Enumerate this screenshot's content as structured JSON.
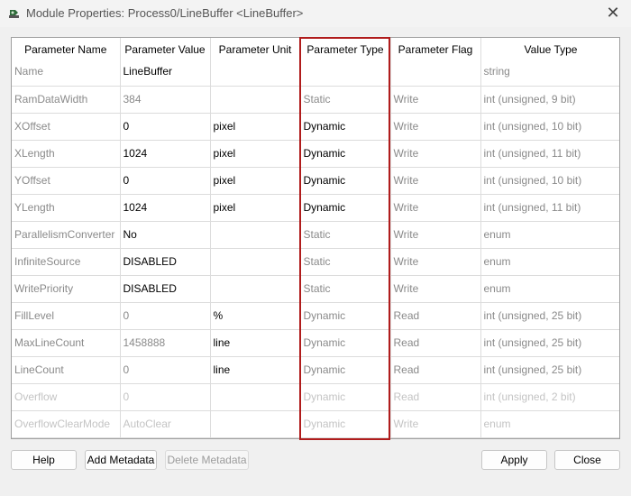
{
  "window": {
    "title": "Module Properties: Process0/LineBuffer <LineBuffer>",
    "close_glyph": "✕",
    "icon": "module-icon"
  },
  "table": {
    "headers": [
      "Parameter Name",
      "Parameter Value",
      "Parameter Unit",
      "Parameter Type",
      "Parameter Flag",
      "Value Type"
    ],
    "rows": [
      {
        "name": "Name",
        "value": "LineBuffer",
        "unit": "",
        "type": "",
        "flag": "",
        "vtype": "string",
        "style": [
          "g",
          "k",
          "g",
          "g",
          "g",
          "g"
        ]
      },
      {
        "name": "RamDataWidth",
        "value": "384",
        "unit": "",
        "type": "Static",
        "flag": "Write",
        "vtype": "int (unsigned, 9 bit)",
        "style": [
          "g",
          "g",
          "g",
          "g",
          "g",
          "g"
        ]
      },
      {
        "name": "XOffset",
        "value": "0",
        "unit": "pixel",
        "type": "Dynamic",
        "flag": "Write",
        "vtype": "int (unsigned, 10 bit)",
        "style": [
          "g",
          "k",
          "k",
          "k",
          "g",
          "g"
        ]
      },
      {
        "name": "XLength",
        "value": "1024",
        "unit": "pixel",
        "type": "Dynamic",
        "flag": "Write",
        "vtype": "int (unsigned, 11 bit)",
        "style": [
          "g",
          "k",
          "k",
          "k",
          "g",
          "g"
        ]
      },
      {
        "name": "YOffset",
        "value": "0",
        "unit": "pixel",
        "type": "Dynamic",
        "flag": "Write",
        "vtype": "int (unsigned, 10 bit)",
        "style": [
          "g",
          "k",
          "k",
          "k",
          "g",
          "g"
        ]
      },
      {
        "name": "YLength",
        "value": "1024",
        "unit": "pixel",
        "type": "Dynamic",
        "flag": "Write",
        "vtype": "int (unsigned, 11 bit)",
        "style": [
          "g",
          "k",
          "k",
          "k",
          "g",
          "g"
        ]
      },
      {
        "name": "ParallelismConverter",
        "value": "No",
        "unit": "",
        "type": "Static",
        "flag": "Write",
        "vtype": "enum",
        "style": [
          "g",
          "k",
          "g",
          "g",
          "g",
          "g"
        ]
      },
      {
        "name": "InfiniteSource",
        "value": "DISABLED",
        "unit": "",
        "type": "Static",
        "flag": "Write",
        "vtype": "enum",
        "style": [
          "g",
          "k",
          "g",
          "g",
          "g",
          "g"
        ]
      },
      {
        "name": "WritePriority",
        "value": "DISABLED",
        "unit": "",
        "type": "Static",
        "flag": "Write",
        "vtype": "enum",
        "style": [
          "g",
          "k",
          "g",
          "g",
          "g",
          "g"
        ]
      },
      {
        "name": "FillLevel",
        "value": "0",
        "unit": "%",
        "type": "Dynamic",
        "flag": "Read",
        "vtype": "int (unsigned, 25 bit)",
        "style": [
          "g",
          "g",
          "k",
          "g",
          "g",
          "g"
        ]
      },
      {
        "name": "MaxLineCount",
        "value": "1458888",
        "unit": "line",
        "type": "Dynamic",
        "flag": "Read",
        "vtype": "int (unsigned, 25 bit)",
        "style": [
          "g",
          "g",
          "k",
          "g",
          "g",
          "g"
        ]
      },
      {
        "name": "LineCount",
        "value": "0",
        "unit": "line",
        "type": "Dynamic",
        "flag": "Read",
        "vtype": "int (unsigned, 25 bit)",
        "style": [
          "g",
          "g",
          "k",
          "g",
          "g",
          "g"
        ]
      },
      {
        "name": "Overflow",
        "value": "0",
        "unit": "",
        "type": "Dynamic",
        "flag": "Read",
        "vtype": "int (unsigned, 2 bit)",
        "style": [
          "d",
          "d",
          "d",
          "d",
          "d",
          "d"
        ]
      },
      {
        "name": "OverflowClearMode",
        "value": "AutoClear",
        "unit": "",
        "type": "Dynamic",
        "flag": "Write",
        "vtype": "enum",
        "style": [
          "d",
          "d",
          "d",
          "d",
          "d",
          "d"
        ]
      }
    ]
  },
  "buttons": {
    "help": "Help",
    "add_metadata": "Add Metadata",
    "delete_metadata": "Delete Metadata",
    "apply": "Apply",
    "close": "Close"
  },
  "colors": {
    "highlight": "#b01c1c"
  }
}
